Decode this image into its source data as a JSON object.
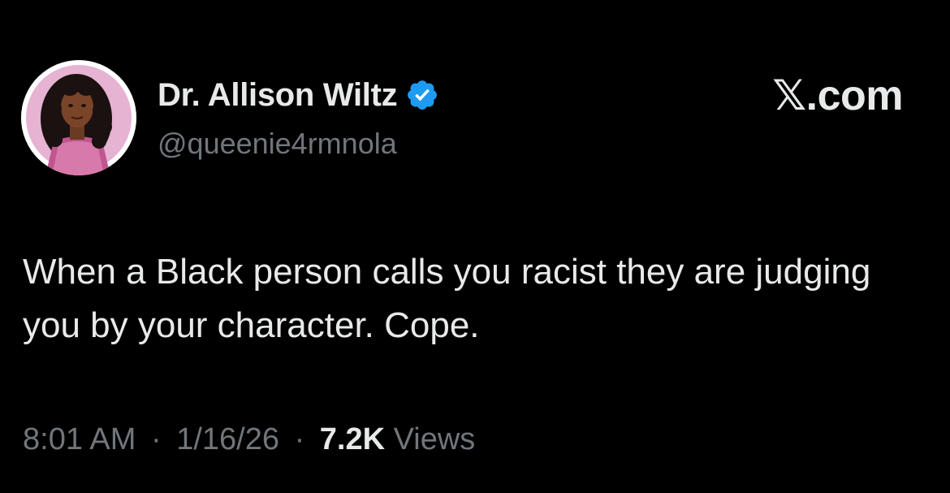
{
  "author": {
    "display_name": "Dr. Allison Wiltz",
    "handle": "@queenie4rmnola",
    "verified": true,
    "avatar_icon": "profile-photo"
  },
  "brand": {
    "label": "𝕏.com"
  },
  "tweet": {
    "text": "When a Black person calls you racist they are judging you by your character. Cope."
  },
  "meta": {
    "time": "8:01 AM",
    "date": "1/16/26",
    "separator": "·",
    "views_count": "7.2K",
    "views_label": "Views"
  },
  "colors": {
    "background": "#000000",
    "primary_text": "#e7e9ea",
    "secondary_text": "#71767b",
    "verified_badge": "#1d9bf0"
  }
}
